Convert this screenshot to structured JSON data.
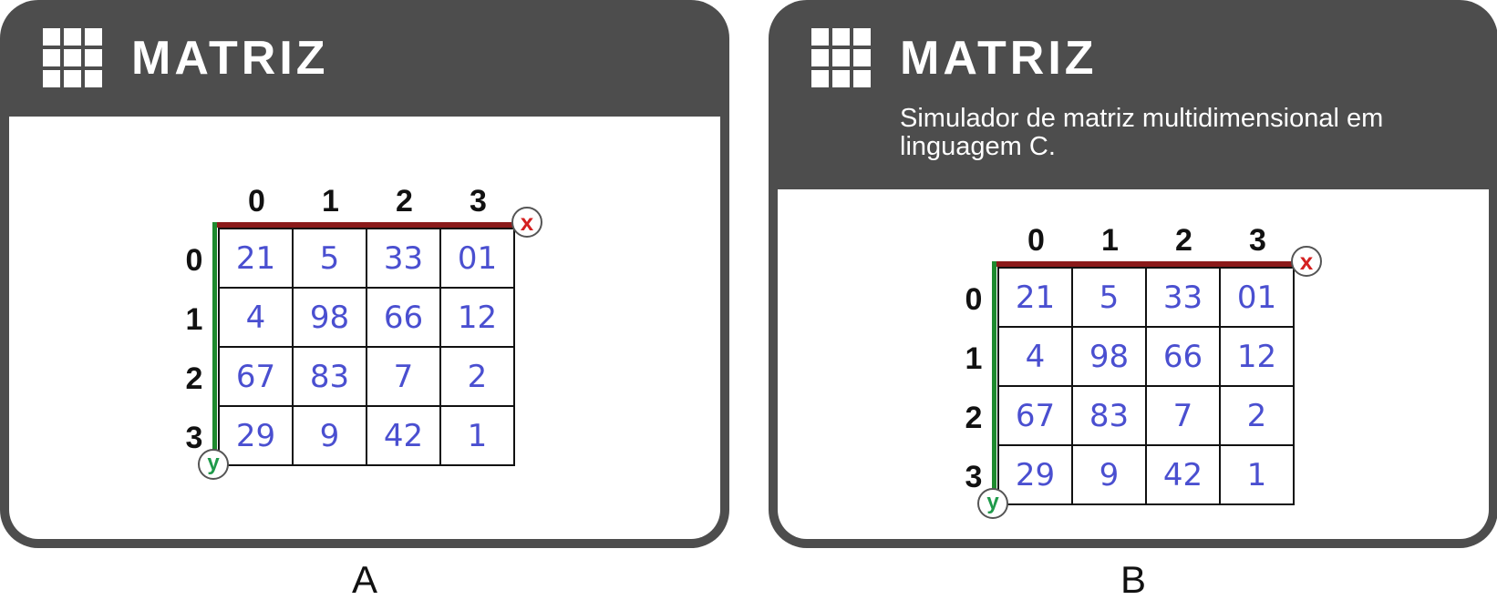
{
  "panels": [
    {
      "title": "MATRIZ",
      "subtitle": "",
      "caption": "A",
      "column_labels": [
        "0",
        "1",
        "2",
        "3"
      ],
      "row_labels": [
        "0",
        "1",
        "2",
        "3"
      ],
      "cells": [
        [
          "21",
          "5",
          "33",
          "01"
        ],
        [
          "4",
          "98",
          "66",
          "12"
        ],
        [
          "67",
          "83",
          "7",
          "2"
        ],
        [
          "29",
          "9",
          "42",
          "1"
        ]
      ],
      "x_marker": "x",
      "y_marker": "y"
    },
    {
      "title": "MATRIZ",
      "subtitle": "Simulador de matriz multidimensional em linguagem C.",
      "caption": "B",
      "column_labels": [
        "0",
        "1",
        "2",
        "3"
      ],
      "row_labels": [
        "0",
        "1",
        "2",
        "3"
      ],
      "cells": [
        [
          "21",
          "5",
          "33",
          "01"
        ],
        [
          "4",
          "98",
          "66",
          "12"
        ],
        [
          "67",
          "83",
          "7",
          "2"
        ],
        [
          "29",
          "9",
          "42",
          "1"
        ]
      ],
      "x_marker": "x",
      "y_marker": "y"
    }
  ],
  "colors": {
    "header_background": "#4d4d4d",
    "cell_text": "#4a4fd0",
    "x_axis": "#8b1a1a",
    "y_axis": "#1e8a2e",
    "x_marker": "#d42020",
    "y_marker": "#1e9a4a"
  },
  "icons": {
    "logo": "grid-icon"
  }
}
